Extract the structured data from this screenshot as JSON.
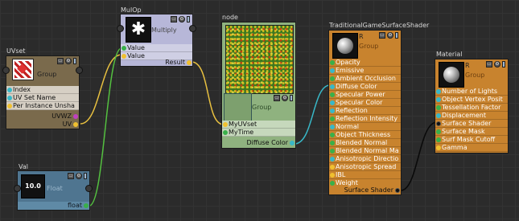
{
  "nodes": {
    "uvset": {
      "title": "UVset",
      "group_label": "Group",
      "inputs": [
        "Index",
        "UV Set Name",
        "Per Instance Unsha"
      ],
      "outputs": [
        "UVWZ",
        "UV"
      ]
    },
    "mulop": {
      "title": "MulOp",
      "preview_glyph": "✱",
      "label": "Multiply",
      "inputs": [
        "Value",
        "Value"
      ],
      "output": "Result"
    },
    "val": {
      "title": "Val",
      "value": "10.0",
      "label": "Float",
      "output": "float"
    },
    "node": {
      "title": "node",
      "group_label": "Group",
      "inputs": [
        "MyUVset",
        "MyTime"
      ],
      "output": "Diffuse Color"
    },
    "tgss": {
      "title": "TraditionalGameSurfaceShader",
      "head_r": "R",
      "group_label": "Group",
      "inputs": [
        "Opacity",
        "Emissive",
        "Ambient Occlusion",
        "Diffuse Color",
        "Specular Power",
        "Specular Color",
        "Reflection",
        "Reflection Intensity",
        "Normal",
        "Object Thickness",
        "Blended Normal",
        "Blended Normal Ma",
        "Anisotropic Directio",
        "Anisotropic Spread",
        "IBL",
        "Weight"
      ],
      "output": "Surface Shader"
    },
    "material": {
      "title": "Material",
      "head_r": "R",
      "group_label": "Group",
      "inputs": [
        "Number of Lights",
        "Object Vertex Posit",
        "Tessellation Factor",
        "Displacement",
        "Surface Shader",
        "Surface Mask",
        "Surf Mask Cutoff",
        "Gamma"
      ]
    }
  },
  "colors": {
    "brown_node": "#7a6a4c",
    "lavender_node": "#b7b7d8",
    "green_node": "#8fb27f",
    "blue_node": "#4f7590",
    "orange_node": "#c8832e",
    "wire_green": "#54c040",
    "wire_yellow": "#e8c040",
    "wire_cyan": "#38b8c8",
    "wire_black": "#0a0a0a"
  }
}
